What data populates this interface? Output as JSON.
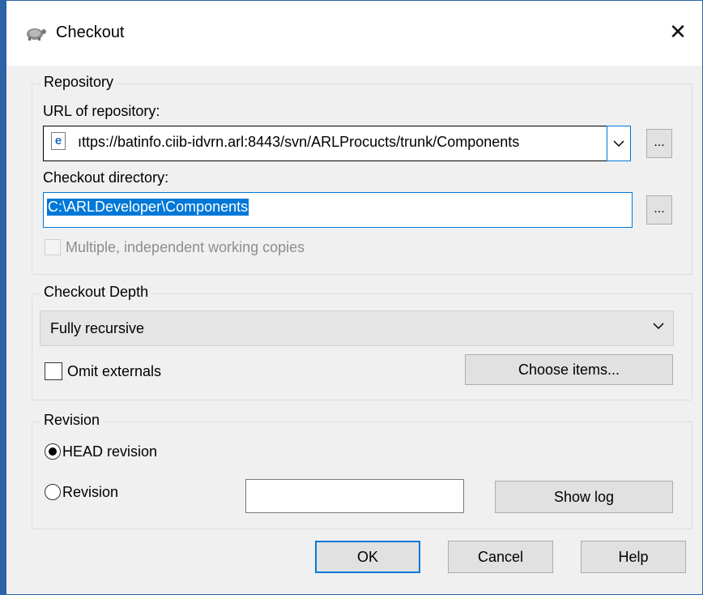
{
  "window": {
    "title": "Checkout",
    "close_glyph": "✕",
    "app_icon": "tortoisesvn-icon"
  },
  "repository": {
    "group_label": "Repository",
    "url_label": "URL of repository:",
    "url_value": "ıttps://batinfo.ciib-idvrn.arl:8443/svn/ARLProcucts/trunk/Components",
    "url_icon": "ie-icon",
    "url_icon_glyph": "e",
    "browse_label": "...",
    "dir_label": "Checkout directory:",
    "dir_value": "C:\\ARLDeveloper\\Components",
    "multiple_copies_label": "Multiple, independent working copies",
    "multiple_copies_checked": false
  },
  "depth": {
    "group_label": "Checkout Depth",
    "selected": "Fully recursive",
    "omit_externals_label": "Omit externals",
    "omit_externals_checked": false,
    "choose_items_label": "Choose items..."
  },
  "revision": {
    "group_label": "Revision",
    "head_label": "HEAD revision",
    "head_selected": true,
    "revision_label": "Revision",
    "revision_value": "",
    "show_log_label": "Show log"
  },
  "buttons": {
    "ok": "OK",
    "cancel": "Cancel",
    "help": "Help"
  },
  "colors": {
    "accent": "#0078d7",
    "window_border": "#2b63a8",
    "dialog_bg": "#f0f0f0"
  }
}
